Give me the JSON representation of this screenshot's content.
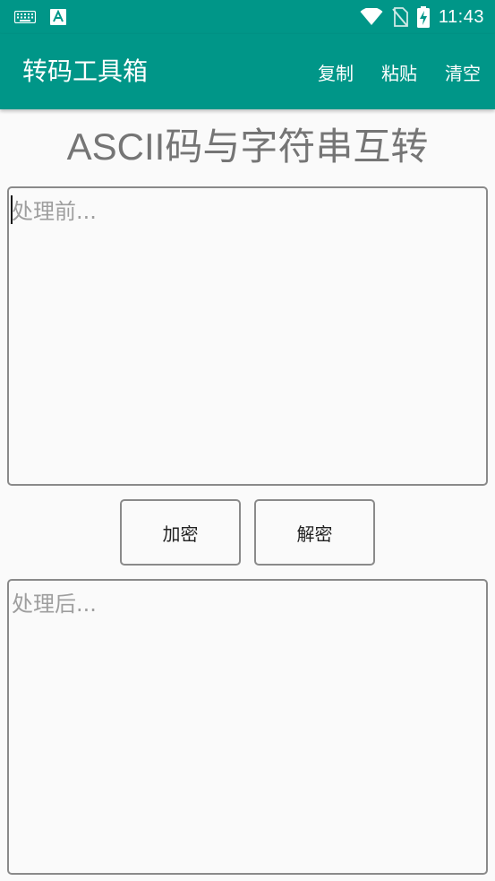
{
  "status_bar": {
    "time": "11:43",
    "icons": [
      "keyboard-icon",
      "accessibility-a-icon",
      "wifi-icon",
      "no-sim-icon",
      "battery-charging-icon"
    ]
  },
  "app_bar": {
    "title": "转码工具箱",
    "actions": [
      {
        "label": "复制"
      },
      {
        "label": "粘贴"
      },
      {
        "label": "清空"
      }
    ]
  },
  "main": {
    "heading": "ASCII码与字符串互转",
    "input": {
      "value": "",
      "placeholder": "处理前..."
    },
    "buttons": {
      "encrypt": "加密",
      "decrypt": "解密"
    },
    "output": {
      "value": "",
      "placeholder": "处理后..."
    }
  },
  "colors": {
    "primary": "#009688",
    "background": "#FAFAFA",
    "border": "#8A8A8A",
    "heading": "#757575",
    "placeholder": "#9E9E9E"
  }
}
